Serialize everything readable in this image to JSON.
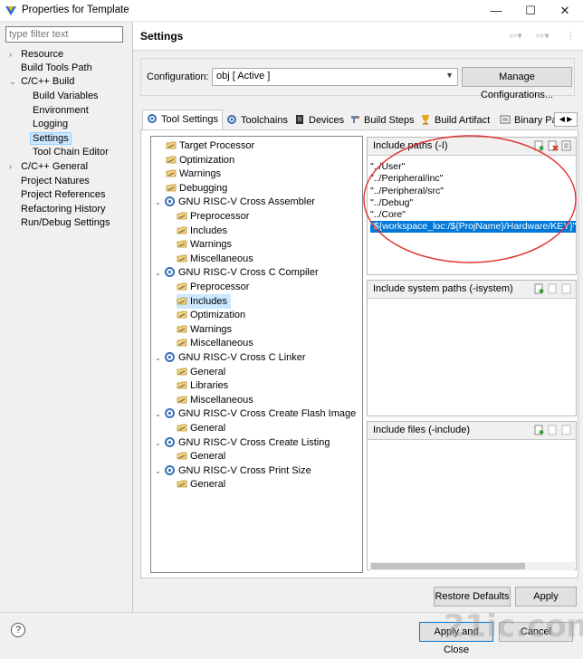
{
  "window": {
    "title": "Properties for Template"
  },
  "nav": {
    "filter_placeholder": "type filter text",
    "items": [
      {
        "label": "Resource",
        "expander": "›"
      },
      {
        "label": "Build Tools Path",
        "expander": ""
      },
      {
        "label": "C/C++ Build",
        "expander": "⌄"
      },
      {
        "label": "Build Variables",
        "expander": ""
      },
      {
        "label": "Environment",
        "expander": ""
      },
      {
        "label": "Logging",
        "expander": ""
      },
      {
        "label": "Settings",
        "expander": ""
      },
      {
        "label": "Tool Chain Editor",
        "expander": ""
      },
      {
        "label": "C/C++ General",
        "expander": "›"
      },
      {
        "label": "Project Natures",
        "expander": ""
      },
      {
        "label": "Project References",
        "expander": ""
      },
      {
        "label": "Refactoring History",
        "expander": ""
      },
      {
        "label": "Run/Debug Settings",
        "expander": ""
      }
    ]
  },
  "header": {
    "title": "Settings"
  },
  "config": {
    "label": "Configuration:",
    "value": "obj  [ Active ]",
    "manage_label": "Manage Configurations..."
  },
  "tabs": [
    {
      "label": "Tool Settings",
      "icon": "tool-settings-icon"
    },
    {
      "label": "Toolchains",
      "icon": "toolchains-icon"
    },
    {
      "label": "Devices",
      "icon": "devices-icon"
    },
    {
      "label": "Build Steps",
      "icon": "build-steps-icon"
    },
    {
      "label": "Build Artifact",
      "icon": "build-artifact-icon"
    },
    {
      "label": "Binary Pa",
      "icon": "binary-parsers-icon"
    }
  ],
  "tool_tree": [
    {
      "label": "Target Processor",
      "kind": "leaf"
    },
    {
      "label": "Optimization",
      "kind": "leaf"
    },
    {
      "label": "Warnings",
      "kind": "leaf"
    },
    {
      "label": "Debugging",
      "kind": "leaf"
    },
    {
      "label": "GNU RISC-V Cross Assembler",
      "kind": "tool"
    },
    {
      "label": "Preprocessor",
      "kind": "child"
    },
    {
      "label": "Includes",
      "kind": "child"
    },
    {
      "label": "Warnings",
      "kind": "child"
    },
    {
      "label": "Miscellaneous",
      "kind": "child"
    },
    {
      "label": "GNU RISC-V Cross C Compiler",
      "kind": "tool"
    },
    {
      "label": "Preprocessor",
      "kind": "child"
    },
    {
      "label": "Includes",
      "kind": "child",
      "selected": true
    },
    {
      "label": "Optimization",
      "kind": "child"
    },
    {
      "label": "Warnings",
      "kind": "child"
    },
    {
      "label": "Miscellaneous",
      "kind": "child"
    },
    {
      "label": "GNU RISC-V Cross C Linker",
      "kind": "tool"
    },
    {
      "label": "General",
      "kind": "child"
    },
    {
      "label": "Libraries",
      "kind": "child"
    },
    {
      "label": "Miscellaneous",
      "kind": "child"
    },
    {
      "label": "GNU RISC-V Cross Create Flash Image",
      "kind": "tool"
    },
    {
      "label": "General",
      "kind": "child"
    },
    {
      "label": "GNU RISC-V Cross Create Listing",
      "kind": "tool"
    },
    {
      "label": "General",
      "kind": "child"
    },
    {
      "label": "GNU RISC-V Cross Print Size",
      "kind": "tool"
    },
    {
      "label": "General",
      "kind": "child"
    }
  ],
  "include_paths": {
    "title": "Include paths (-I)",
    "paths": [
      "\"../User\"",
      "\"../Peripheral/inc\"",
      "\"../Peripheral/src\"",
      "\"../Debug\"",
      "\"../Core\"",
      "\"${workspace_loc:/${ProjName}/Hardware/KEY}\""
    ]
  },
  "include_system_paths": {
    "title": "Include system paths (-isystem)"
  },
  "include_files": {
    "title": "Include files (-include)"
  },
  "buttons": {
    "restore": "Restore Defaults",
    "apply": "Apply",
    "apply_close": "Apply and Close",
    "cancel": "Cancel"
  },
  "watermark": "21ic.com",
  "colors": {
    "selection": "#0078d7",
    "tree_selection": "#cce8ff",
    "annotation_circle": "#e0302e"
  }
}
